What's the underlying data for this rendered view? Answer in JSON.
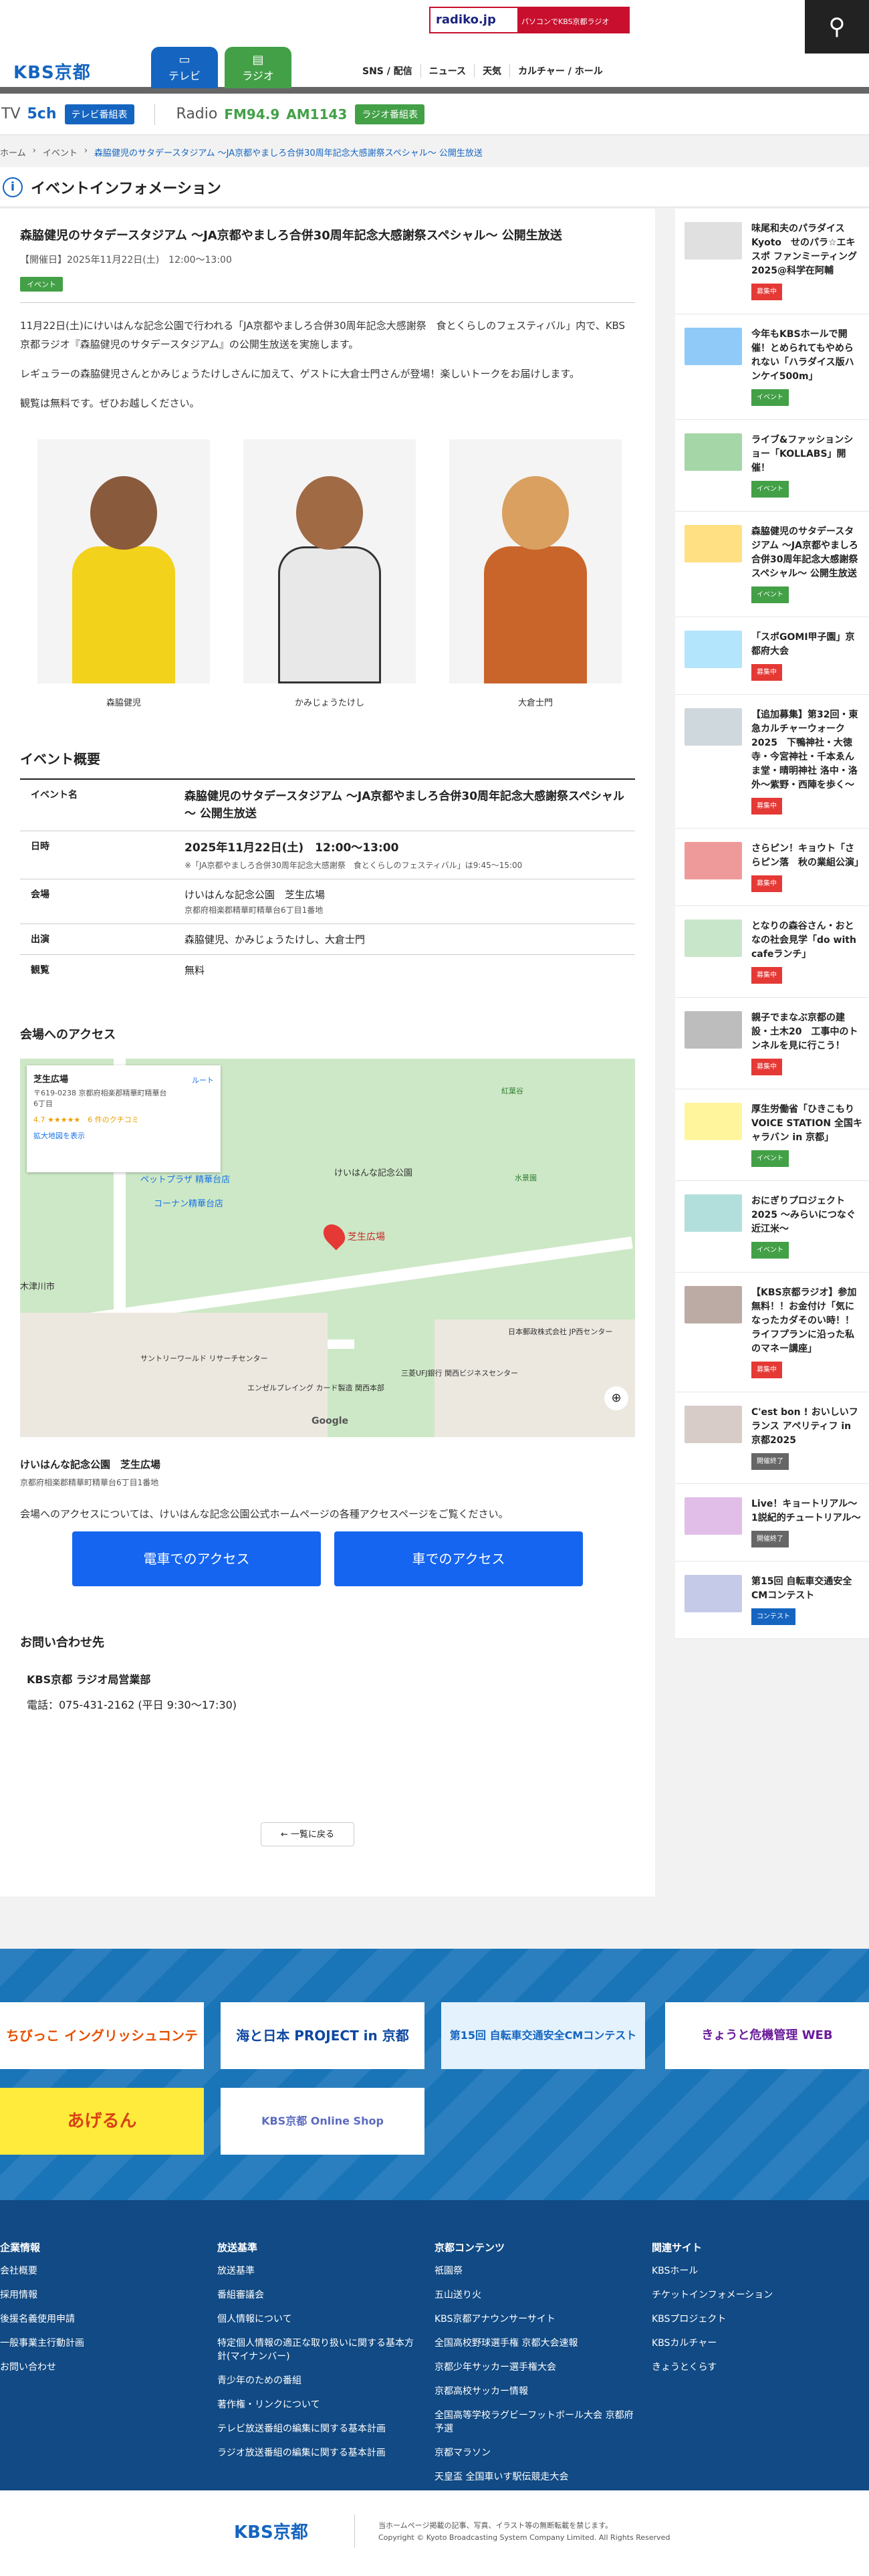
{
  "header": {
    "logo": "KBS京都",
    "tab_tv": "テレビ",
    "tab_radio": "ラジオ",
    "radiko_logo": "radiko.jp",
    "radiko_text": "パソコンでKBS京都ラジオ",
    "nav": [
      "SNS / 配信",
      "ニュース",
      "天気",
      "カルチャー / ホール"
    ]
  },
  "channel": {
    "tv_label": "TV",
    "tv_ch": "5ch",
    "tv_btn": "テレビ番組表",
    "radio_label": "Radio",
    "fm": "FM94.9",
    "am": "AM1143",
    "radio_btn": "ラジオ番組表"
  },
  "crumb": {
    "home": "ホーム",
    "sep1": "›",
    "event": "イベント",
    "sep2": "›",
    "current": "森脇健児のサタデースタジアム ～JA京都やましろ合併30周年記念大感謝祭スペシャル～ 公開生放送"
  },
  "section_title": "イベントインフォメーション",
  "article": {
    "title": "森脇健児のサタデースタジアム ～JA京都やましろ合併30周年記念大感謝祭スペシャル～ 公開生放送",
    "date": "【開催日】2025年11月22日(土)　12:00～13:00",
    "category": "イベント",
    "p1": "11月22日(土)にけいはんな記念公園で行われる「JA京都やましろ合併30周年記念大感謝祭　食とくらしのフェスティバル」内で、KBS京都ラジオ『森脇健児のサタデースタジアム』の公開生放送を実施します。",
    "p2": "レギュラーの森脇健児さんとかみじょうたけしさんに加えて、ゲストに大倉士門さんが登場！楽しいトークをお届けします。",
    "p3": "観覧は無料です。ぜひお越しください。",
    "photos": [
      "森脇健児",
      "かみじょうたけし",
      "大倉士門"
    ]
  },
  "overview": {
    "heading": "イベント概要",
    "k_name": "イベント名",
    "v_name": "森脇健児のサタデースタジアム ～JA京都やましろ合併30周年記念大感謝祭スペシャル～ 公開生放送",
    "k_date": "日時",
    "v_date": "2025年11月22日(土)　12:00～13:00",
    "v_date_note": "※「JA京都やましろ合併30周年記念大感謝祭　食とくらしのフェスティバル」は9:45～15:00",
    "k_venue": "会場",
    "v_venue": "けいはんな記念公園　芝生広場",
    "v_venue_addr": "京都府相楽郡精華町精華台6丁目1番地",
    "k_cast": "出演",
    "v_cast": "森脇健児、かみじょうたけし、大倉士門",
    "k_fee": "観覧",
    "v_fee": "無料"
  },
  "access": {
    "heading": "会場へのアクセス",
    "map_place": "芝生広場",
    "map_addr": "〒619-0238 京都府相楽郡精華町精華台6丁目",
    "map_rating": "4.7 ★★★★★　6 件のクチコミ",
    "map_link": "拡大地図を表示",
    "map_route": "ルート",
    "map_labels": [
      "けいはんな記念公園",
      "ペットプラザ 精華台店",
      "コーナン精華台店",
      "木津川市",
      "日本郵政株式会社 JP西センター",
      "サントリーワールド リサーチセンター",
      "エンゼルプレイング カード製造 関西本部",
      "三菱UFJ銀行 関西ビジネスセンター",
      "水景園",
      "紅葉谷"
    ],
    "map_pin_label": "芝生広場",
    "google": "Google",
    "place_name": "けいはんな記念公園　芝生広場",
    "place_addr": "京都府相楽郡精華町精華台6丁目1番地",
    "note": "会場へのアクセスについては、けいはんな記念公園公式ホームページの各種アクセスページをご覧ください。",
    "btn_train": "電車でのアクセス",
    "btn_car": "車でのアクセス"
  },
  "contact": {
    "heading": "お問い合わせ先",
    "org": "KBS京都 ラジオ局営業部",
    "tel": "電話：075-431-2162 (平日 9:30～17:30)"
  },
  "back_label": "← 一覧に戻る",
  "sidebar": [
    {
      "title": "味尾和夫のパラダイスKyoto　せのパラ☆エキスポ ファンミーティング2025@科学在阿輔",
      "badge": "募集中",
      "color": "#e53935"
    },
    {
      "title": "今年もKBSホールで開催！とめられてもやめられない「ハラダイス版ハンケイ500m」",
      "badge": "イベント",
      "color": "#43a047"
    },
    {
      "title": "ライブ&ファッションショー「KOLLABS」開催！",
      "badge": "イベント",
      "color": "#43a047"
    },
    {
      "title": "森脇健児のサタデースタジアム ～JA京都やましろ合併30周年記念大感謝祭スペシャル～ 公開生放送",
      "badge": "イベント",
      "color": "#43a047"
    },
    {
      "title": "「スポGOMI甲子園」京都府大会",
      "badge": "募集中",
      "color": "#e53935"
    },
    {
      "title": "【追加募集】第32回・東急カルチャーウォーク2025　下鴨神社・大徳寺・今宮神社・千本ゑんま堂・晴明神社 洛中・洛外～紫野・西陣を歩く～",
      "badge": "募集中",
      "color": "#e53935"
    },
    {
      "title": "さらピン！キョウト「さらピン落　秋の業組公演」",
      "badge": "募集中",
      "color": "#e53935"
    },
    {
      "title": "となりの森谷さん・おとなの社会見学「do with cafeランチ」",
      "badge": "募集中",
      "color": "#e53935"
    },
    {
      "title": "親子でまなぶ京都の建設・土木20　工事中のトンネルを見に行こう！",
      "badge": "募集中",
      "color": "#e53935"
    },
    {
      "title": "厚生労働省「ひきこもり VOICE STATION 全国キャラバン in 京都」",
      "badge": "イベント",
      "color": "#43a047"
    },
    {
      "title": "おにぎりプロジェクト2025 ～みらいにつなぐ近江米～",
      "badge": "イベント",
      "color": "#43a047"
    },
    {
      "title": "【KBS京都ラジオ】参加無料！！お金付け「気になったカダそのい時！！ライフプランに沿った私のマネー講座」",
      "badge": "募集中",
      "color": "#e53935"
    },
    {
      "title": "C'est bon ! おいしいフランス アペリティフ in 京都2025",
      "badge": "開催終了",
      "color": "#666666"
    },
    {
      "title": "Live！キョートリアル～1説紀的チュートリアル～",
      "badge": "開催終了",
      "color": "#666666"
    },
    {
      "title": "第15回 自転車交通安全CMコンテスト",
      "badge": "コンテスト",
      "color": "#1565c0"
    }
  ],
  "banners": [
    "ちびっこ イングリッシュコンテスト",
    "海と日本 PROJECT in 京都",
    "第15回 自転車交通安全CMコンテスト",
    "きょうと危機管理 WEB",
    "あげるん",
    "KBS京都 Online Shop"
  ],
  "footer": {
    "col1_title": "企業情報",
    "col1": [
      "会社概要",
      "採用情報",
      "後援名義使用申請",
      "一般事業主行動計画",
      "お問い合わせ"
    ],
    "col2_title": "放送基準",
    "col2": [
      "放送基準",
      "番組審議会",
      "個人情報について",
      "特定個人情報の適正な取り扱いに関する基本方針(マイナンバー)",
      "青少年のための番組",
      "著作権・リンクについて",
      "テレビ放送番組の編集に関する基本計画",
      "ラジオ放送番組の編集に関する基本計画"
    ],
    "col3_title": "京都コンテンツ",
    "col3": [
      "祇園祭",
      "五山送り火",
      "KBS京都アナウンサーサイト",
      "全国高校野球選手権 京都大会速報",
      "京都少年サッカー選手権大会",
      "京都高校サッカー情報",
      "全国高等学校ラグビーフットボール大会 京都府予選",
      "京都マラソン",
      "天皇盃 全国車いす駅伝競走大会"
    ],
    "col4_title": "関連サイト",
    "col4": [
      "KBSホール",
      "チケットインフォメーション",
      "KBSプロジェクト",
      "KBSカルチャー",
      "きょうとくらす"
    ],
    "logo": "KBS京都",
    "note1": "当ホームページ掲載の記事、写真、イラスト等の無断転載を禁じます。",
    "note2": "Copyright © Kyoto Broadcasting System Company Limited. All Rights Reserved"
  }
}
